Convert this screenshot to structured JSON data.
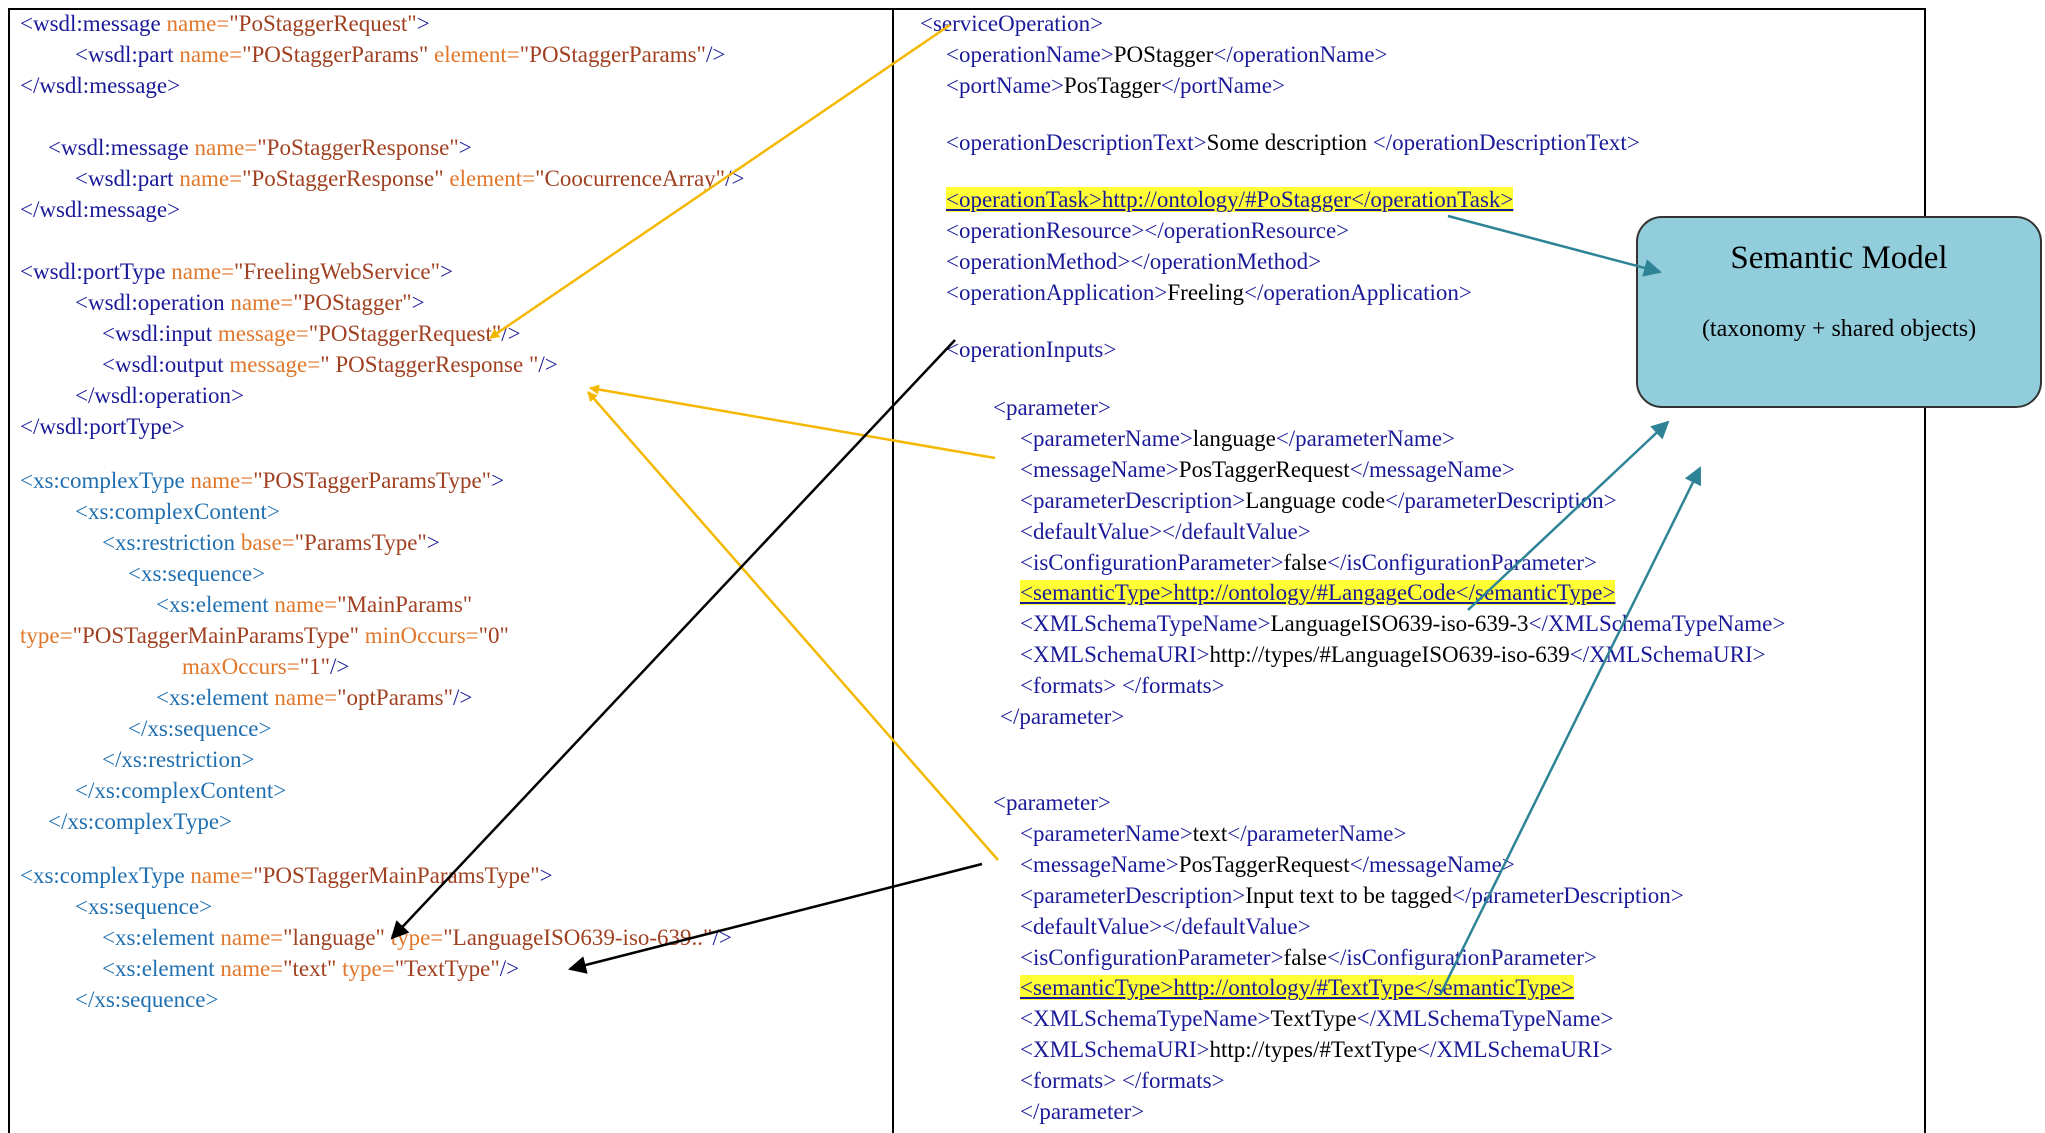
{
  "left": {
    "l1": [
      "<wsdl:message ",
      "name=",
      "\"PoStaggerRequest\"",
      ">"
    ],
    "l2": [
      "<wsdl:part ",
      "name=",
      "\"POStaggerParams\" ",
      "element=",
      "\"POStaggerParams\"",
      "/>"
    ],
    "l3": "</wsdl:message>",
    "l4": [
      "<wsdl:message ",
      "name=",
      "\"PoStaggerResponse\"",
      ">"
    ],
    "l5": [
      "<wsdl:part ",
      "name=",
      "\"PoStaggerResponse\" ",
      "element=",
      "\"CoocurrenceArray\"",
      "/>"
    ],
    "l6": "</wsdl:message>",
    "l7": [
      "<wsdl:portType ",
      "name=",
      "\"FreelingWebService\"",
      ">"
    ],
    "l8": [
      "<wsdl:operation ",
      "name=",
      "\"POStagger\"",
      ">"
    ],
    "l9": [
      "<wsdl:input ",
      "message=",
      "\"POStaggerRequest\"",
      "/>"
    ],
    "l10": [
      "<wsdl:output ",
      "message=",
      "\" POStaggerResponse \"",
      "/>"
    ],
    "l11": "</wsdl:operation>",
    "l12": "</wsdl:portType>",
    "l13": [
      "<xs:complexType ",
      "name=",
      "\"POSTaggerParamsType\"",
      ">"
    ],
    "l14": "<xs:complexContent>",
    "l15": [
      "<xs:restriction ",
      "base=",
      "\"ParamsType\"",
      ">"
    ],
    "l16": "<xs:sequence>",
    "l17": [
      "<xs:element ",
      "name=",
      "\"MainParams\""
    ],
    "l18": [
      "type=",
      "\"POSTaggerMainParamsType\" ",
      "minOccurs=",
      "\"0\""
    ],
    "l19": [
      "maxOccurs=",
      "\"1\"",
      "/>"
    ],
    "l20": [
      "<xs:element ",
      "name=",
      "\"optParams\"",
      "/>"
    ],
    "l21": "</xs:sequence>",
    "l22": "</xs:restriction>",
    "l23": "</xs:complexContent>",
    "l24": "</xs:complexType>",
    "l25": [
      "<xs:complexType ",
      "name=",
      "\"POSTaggerMainParamsType\"",
      ">"
    ],
    "l26": "<xs:sequence>",
    "l27": [
      "<xs:element ",
      "name=",
      "\"language\" ",
      "type=",
      "\"LanguageISO639-iso-639..\"",
      "/>"
    ],
    "l28": [
      "<xs:element ",
      "name=",
      "\"text\" ",
      "type=",
      "\"TextType\"",
      "/>"
    ],
    "l29": "</xs:sequence>"
  },
  "right": {
    "r1": "<serviceOperation>",
    "r2": [
      "<operationName>",
      "POStagger",
      "</operationName>"
    ],
    "r3": [
      "<portName>",
      "PosTagger",
      "</portName>"
    ],
    "r4": [
      "<operationDescriptionText>",
      "Some description ",
      "</operationDescriptionText>"
    ],
    "r5": "<operationTask>http://ontology/#PoStagger</operationTask>",
    "r6": "<operationResource></operationResource>",
    "r7": "<operationMethod></operationMethod>",
    "r8": [
      "<operationApplication>",
      "Freeling",
      "</operationApplication>"
    ],
    "r9": "<operationInputs>",
    "p1": {
      "open": "<parameter>",
      "name": [
        "<parameterName>",
        "language",
        "</parameterName>"
      ],
      "msg": [
        "<messageName>",
        "PosTaggerRequest",
        "</messageName>"
      ],
      "desc": [
        "<parameterDescription>",
        "Language code",
        "</parameterDescription>"
      ],
      "def": "<defaultValue></defaultValue>",
      "cfg": [
        "<isConfigurationParameter>",
        "false",
        "</isConfigurationParameter>"
      ],
      "sem": "<semanticType>http://ontology/#LangageCode</semanticType>",
      "xtn": [
        "<XMLSchemaTypeName>",
        "LanguageISO639-iso-639-3",
        "</XMLSchemaTypeName>"
      ],
      "xuri": [
        "<XMLSchemaURI>",
        "http://types/#LanguageISO639-iso-639",
        "</XMLSchemaURI>"
      ],
      "fmt": "<formats> </formats>",
      "close": "</parameter>"
    },
    "p2": {
      "open": "<parameter>",
      "name": [
        "<parameterName>",
        "text",
        "</parameterName>"
      ],
      "msg": [
        "<messageName>",
        "PosTaggerRequest",
        "</messageName>"
      ],
      "desc": [
        "<parameterDescription>",
        "Input text to be tagged",
        "</parameterDescription>"
      ],
      "def": "<defaultValue></defaultValue>",
      "cfg": [
        "<isConfigurationParameter>",
        "false",
        "</isConfigurationParameter>"
      ],
      "sem": "<semanticType>http://ontology/#TextType</semanticType>",
      "xtn": [
        "<XMLSchemaTypeName>",
        "TextType",
        "</XMLSchemaTypeName>"
      ],
      "xuri": [
        "<XMLSchemaURI>",
        "http://types/#TextType",
        "</XMLSchemaURI>"
      ],
      "fmt": "<formats> </formats>",
      "close": "</parameter>"
    }
  },
  "semantic_model": {
    "title": "Semantic Model",
    "subtitle": "(taxonomy + shared objects)"
  },
  "colors": {
    "markup": "#1a1a99",
    "xs_markup": "#1f6fb0",
    "attr_name": "#e0772a",
    "attr_value": "#a04020",
    "highlight": "#ffff33",
    "box_fill": "#92cddc",
    "arrow_orange": "#f5b800",
    "arrow_teal": "#2e8496",
    "arrow_black": "#000000"
  }
}
